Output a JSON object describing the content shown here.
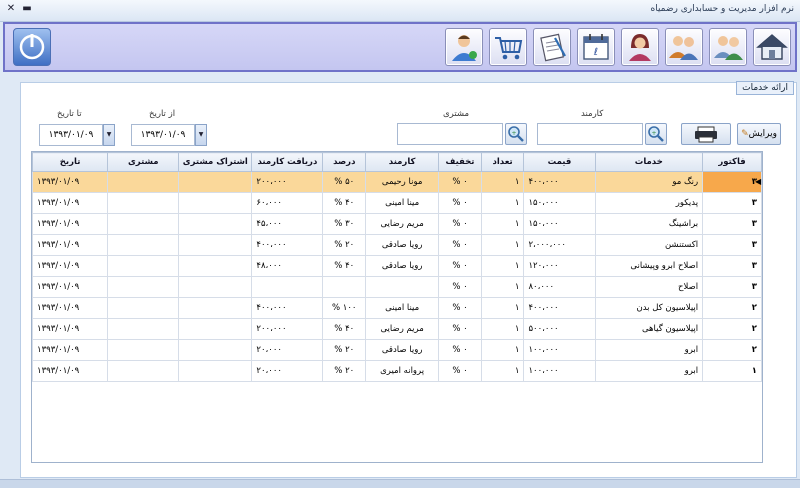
{
  "window": {
    "title": "نرم افزار مدیریت و حسابداری رضمیاه",
    "close_glyph": "✕",
    "minimize_glyph": "▬"
  },
  "toolbar": {
    "buttons": [
      "home-icon",
      "users-icon",
      "customers-icon",
      "female-staff-icon",
      "calendar-icon",
      "notes-icon",
      "cart-icon",
      "employee-icon"
    ],
    "power": "power-icon"
  },
  "panel": {
    "title": "ارائه خدمات"
  },
  "filters": {
    "to_date_label": "تا تاریخ",
    "to_date_value": "۱۳۹۳/۰۱/۰۹",
    "from_date_label": "از تاریخ",
    "from_date_value": "۱۳۹۳/۰۱/۰۹",
    "customer_label": "مشتری",
    "customer_value": "",
    "employee_label": "کارمند",
    "employee_value": "",
    "edit_label": "ویرایش"
  },
  "grid": {
    "columns": [
      "فاکتور",
      "خدمات",
      "قیمت",
      "تعداد",
      "تخفیف",
      "کارمند",
      "درصد",
      "دریافت کارمند",
      "اشتراک مشتری",
      "مشتری",
      "تاریخ"
    ],
    "rows": [
      [
        "۳",
        "رنگ مو",
        "۴۰۰،۰۰۰",
        "۱",
        "۰ %",
        "مونا رحیمی",
        "۵۰ %",
        "۲۰۰،۰۰۰",
        "",
        "",
        "۱۳۹۳/۰۱/۰۹"
      ],
      [
        "۳",
        "پدیکور",
        "۱۵۰،۰۰۰",
        "۱",
        "۰ %",
        "مینا امینی",
        "۴۰ %",
        "۶۰،۰۰۰",
        "",
        "",
        "۱۳۹۳/۰۱/۰۹"
      ],
      [
        "۳",
        "براشینگ",
        "۱۵۰،۰۰۰",
        "۱",
        "۰ %",
        "مریم رضایی",
        "۳۰ %",
        "۴۵،۰۰۰",
        "",
        "",
        "۱۳۹۳/۰۱/۰۹"
      ],
      [
        "۳",
        "اکستنشن",
        "۲،۰۰۰،۰۰۰",
        "۱",
        "۰ %",
        "رویا صادقی",
        "۲۰ %",
        "۴۰۰،۰۰۰",
        "",
        "",
        "۱۳۹۳/۰۱/۰۹"
      ],
      [
        "۳",
        "اصلاح ابرو وپیشانی",
        "۱۲۰،۰۰۰",
        "۱",
        "۰ %",
        "رویا صادقی",
        "۴۰ %",
        "۴۸،۰۰۰",
        "",
        "",
        "۱۳۹۳/۰۱/۰۹"
      ],
      [
        "۳",
        "اصلاح",
        "۸۰،۰۰۰",
        "۱",
        "۰ %",
        "",
        "",
        "",
        "",
        "",
        "۱۳۹۳/۰۱/۰۹"
      ],
      [
        "۲",
        "اپیلاسیون کل بدن",
        "۴۰۰،۰۰۰",
        "۱",
        "۰ %",
        "مینا امینی",
        "۱۰۰ %",
        "۴۰۰،۰۰۰",
        "",
        "",
        "۱۳۹۳/۰۱/۰۹"
      ],
      [
        "۲",
        "اپیلاسیون گیاهی",
        "۵۰۰،۰۰۰",
        "۱",
        "۰ %",
        "مریم رضایی",
        "۴۰ %",
        "۲۰۰،۰۰۰",
        "",
        "",
        "۱۳۹۳/۰۱/۰۹"
      ],
      [
        "۲",
        "ابرو",
        "۱۰۰،۰۰۰",
        "۱",
        "۰ %",
        "رویا صادقی",
        "۲۰ %",
        "۲۰،۰۰۰",
        "",
        "",
        "۱۳۹۳/۰۱/۰۹"
      ],
      [
        "۱",
        "ابرو",
        "۱۰۰،۰۰۰",
        "۱",
        "۰ %",
        "پروانه امیری",
        "۲۰ %",
        "۲۰،۰۰۰",
        "",
        "",
        "۱۳۹۳/۰۱/۰۹"
      ]
    ],
    "selected_row": 0
  }
}
